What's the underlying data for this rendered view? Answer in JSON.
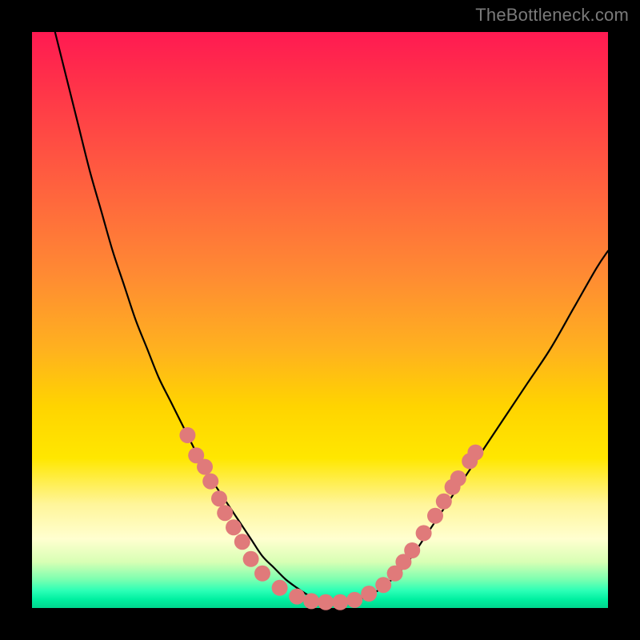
{
  "watermark": "TheBottleneck.com",
  "chart_data": {
    "type": "line",
    "title": "",
    "xlabel": "",
    "ylabel": "",
    "xlim": [
      0,
      100
    ],
    "ylim": [
      0,
      100
    ],
    "grid": false,
    "legend": false,
    "series": [
      {
        "name": "curve",
        "color": "#000000",
        "x": [
          4,
          6,
          8,
          10,
          12,
          14,
          16,
          18,
          20,
          22,
          24,
          26,
          28,
          30,
          32,
          34,
          36,
          38,
          40,
          42,
          44,
          46,
          48,
          50,
          52,
          54,
          56,
          58,
          60,
          62,
          64,
          66,
          68,
          70,
          74,
          78,
          82,
          86,
          90,
          94,
          98,
          100
        ],
        "y": [
          100,
          92,
          84,
          76,
          69,
          62,
          56,
          50,
          45,
          40,
          36,
          32,
          28,
          24,
          21,
          18,
          15,
          12,
          9,
          7,
          5,
          3.5,
          2.2,
          1.3,
          1,
          1,
          1.3,
          2,
          3,
          4.5,
          6.5,
          9,
          12,
          15,
          21,
          27,
          33,
          39,
          45,
          52,
          59,
          62
        ]
      }
    ],
    "markers": [
      {
        "name": "dots",
        "color": "#e07a7a",
        "radius_px": 10,
        "points": [
          {
            "x": 27,
            "y": 30
          },
          {
            "x": 28.5,
            "y": 26.5
          },
          {
            "x": 30,
            "y": 24.5
          },
          {
            "x": 31,
            "y": 22
          },
          {
            "x": 32.5,
            "y": 19
          },
          {
            "x": 33.5,
            "y": 16.5
          },
          {
            "x": 35,
            "y": 14
          },
          {
            "x": 36.5,
            "y": 11.5
          },
          {
            "x": 38,
            "y": 8.5
          },
          {
            "x": 40,
            "y": 6
          },
          {
            "x": 43,
            "y": 3.5
          },
          {
            "x": 46,
            "y": 2
          },
          {
            "x": 48.5,
            "y": 1.2
          },
          {
            "x": 51,
            "y": 1
          },
          {
            "x": 53.5,
            "y": 1
          },
          {
            "x": 56,
            "y": 1.4
          },
          {
            "x": 58.5,
            "y": 2.5
          },
          {
            "x": 61,
            "y": 4
          },
          {
            "x": 63,
            "y": 6
          },
          {
            "x": 64.5,
            "y": 8
          },
          {
            "x": 66,
            "y": 10
          },
          {
            "x": 68,
            "y": 13
          },
          {
            "x": 70,
            "y": 16
          },
          {
            "x": 71.5,
            "y": 18.5
          },
          {
            "x": 73,
            "y": 21
          },
          {
            "x": 74,
            "y": 22.5
          },
          {
            "x": 76,
            "y": 25.5
          },
          {
            "x": 77,
            "y": 27
          }
        ]
      }
    ]
  }
}
